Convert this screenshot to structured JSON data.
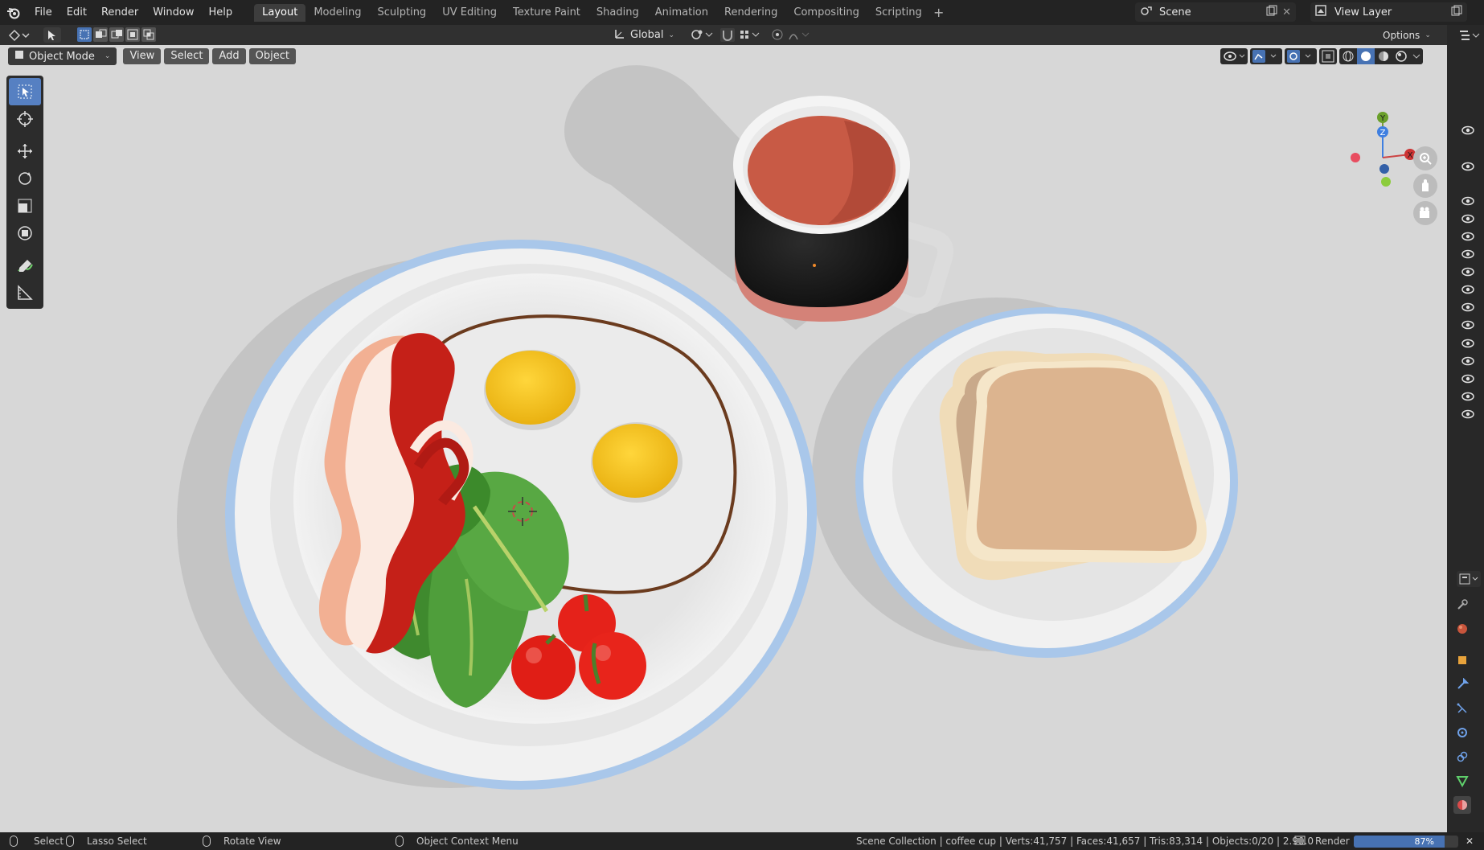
{
  "menu": {
    "items": [
      "File",
      "Edit",
      "Render",
      "Window",
      "Help"
    ]
  },
  "workspaces": {
    "tabs": [
      "Layout",
      "Modeling",
      "Sculpting",
      "UV Editing",
      "Texture Paint",
      "Shading",
      "Animation",
      "Rendering",
      "Compositing",
      "Scripting"
    ],
    "active": "Layout",
    "add_label": "+"
  },
  "scene": {
    "name": "Scene"
  },
  "view_layer": {
    "name": "View Layer"
  },
  "toolbar": {
    "orientation": "Global",
    "options_label": "Options"
  },
  "viewport_header": {
    "mode": "Object Mode",
    "menus": [
      "View",
      "Select",
      "Add",
      "Object"
    ]
  },
  "tools": [
    "select-box",
    "cursor",
    "move",
    "rotate",
    "scale",
    "transform",
    "annotate",
    "measure"
  ],
  "gizmo": {
    "axes": [
      "Y",
      "Z",
      "X"
    ]
  },
  "status": {
    "select": "Select",
    "lasso": "Lasso Select",
    "rotate": "Rotate View",
    "context": "Object Context Menu",
    "stats": "Scene Collection | coffee cup | Verts:41,757 | Faces:41,657 | Tris:83,314 | Objects:0/20 | 2.90.0",
    "render_label": "Render",
    "render_progress": "87%",
    "render_fraction": 0.87
  },
  "colors": {
    "accent": "#4772b3",
    "viewport_bg": "#d7d7d7",
    "coffee": "#c85a45",
    "bacon": "#b8201a",
    "spinach": "#4e9a3a",
    "tomato": "#e01e16",
    "yolk": "#f3c21a",
    "toast": "#dcb48f",
    "plate_rim": "#a9c7ea"
  }
}
